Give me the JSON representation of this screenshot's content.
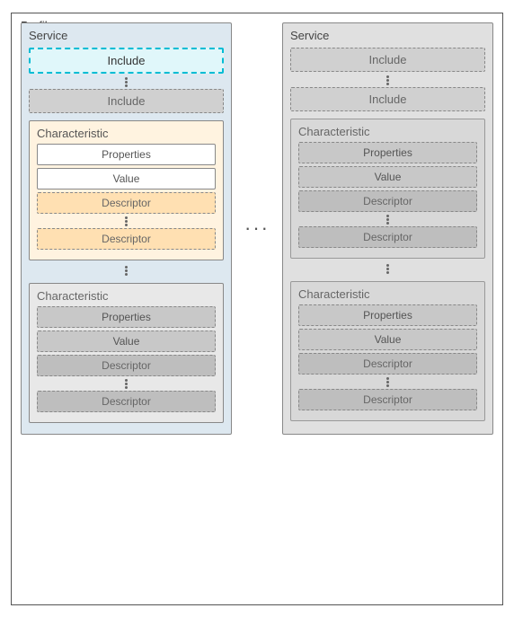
{
  "outer": {
    "label": "Profile"
  },
  "left_service": {
    "label": "Service",
    "include_top_active": "Include",
    "include_bottom": "Include",
    "char1": {
      "label": "Characteristic",
      "properties": "Properties",
      "value": "Value",
      "descriptor1": "Descriptor",
      "descriptor2": "Descriptor"
    },
    "char2": {
      "label": "Characteristic",
      "properties": "Properties",
      "value": "Value",
      "descriptor1": "Descriptor",
      "descriptor2": "Descriptor"
    }
  },
  "right_service": {
    "label": "Service",
    "include_top": "Include",
    "include_bottom": "Include",
    "char1": {
      "label": "Characteristic",
      "properties": "Properties",
      "value": "Value",
      "descriptor1": "Descriptor",
      "descriptor2": "Descriptor"
    },
    "char2": {
      "label": "Characteristic",
      "properties": "Properties",
      "value": "Value",
      "descriptor1": "Descriptor",
      "descriptor2": "Descriptor"
    }
  },
  "dots": "...",
  "ellipsis_h": "···"
}
